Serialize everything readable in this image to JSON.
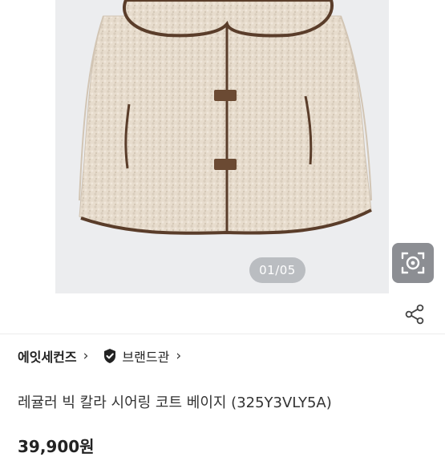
{
  "gallery": {
    "counter": "01/05",
    "current_page": 1,
    "total_pages": 5
  },
  "actions": {
    "lens_icon": "camera-lens-icon",
    "share_icon": "share-icon"
  },
  "shop": {
    "seller_name": "에잇세컨즈",
    "brand_label": "브랜드관",
    "brand_icon": "shield-check-icon"
  },
  "product": {
    "title": "레귤러 빅 칼라 시어링 코트 베이지 (325Y3VLY5A)",
    "price": "39,900원"
  },
  "colors": {
    "background": "#ffffff",
    "image_bg": "#ecedef",
    "coat_fill": "#e6dbcd",
    "trim_brown": "#5a3d2a"
  }
}
